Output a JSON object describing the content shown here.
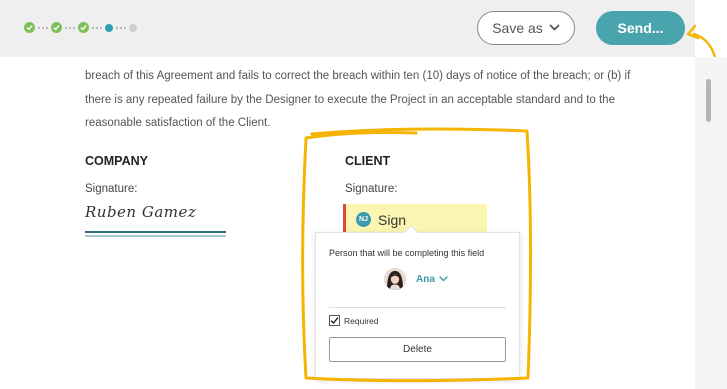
{
  "toolbar": {
    "save_label": "Save as",
    "send_label": "Send..."
  },
  "progress": {
    "completed_steps": 3,
    "current_step": 4,
    "total_steps": 5
  },
  "document": {
    "paragraph_lines": [
      "breach of this Agreement and fails to correct the breach within ten (10) days of notice of the breach; or (b) if",
      "there is any repeated failure by the Designer to execute the Project in an acceptable standard and to the",
      "reasonable satisfaction of the Client."
    ],
    "company": {
      "title": "COMPANY",
      "signature_label": "Signature:",
      "signature_value": "Ruben Gamez"
    },
    "client": {
      "title": "CLIENT",
      "signature_label": "Signature:"
    }
  },
  "sign_field": {
    "initials": "NJ",
    "label": "Sign"
  },
  "popover": {
    "title": "Person that will be completing this field",
    "person_name": "Ana",
    "required_label": "Required",
    "required_checked": true,
    "delete_label": "Delete"
  },
  "colors": {
    "accent": "#4aa4ad",
    "step_done": "#7cc05a",
    "step_current": "#2f9db2",
    "highlight": "#f5b400",
    "sign_field_bg": "#fbf5b2",
    "sign_field_border": "#e0453a"
  }
}
